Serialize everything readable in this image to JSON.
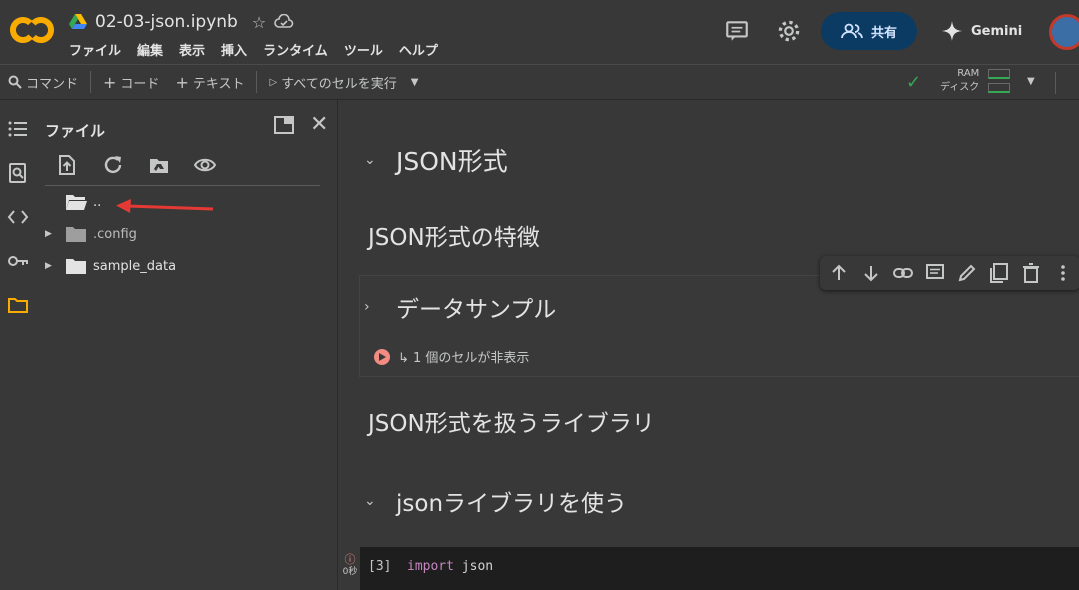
{
  "app": {
    "logo_text": "CO",
    "notebook_title": "02-03-json.ipynb",
    "menu": [
      "ファイル",
      "編集",
      "表示",
      "挿入",
      "ランタイム",
      "ツール",
      "ヘルプ"
    ],
    "share_label": "共有",
    "gemini_label": "Gemini"
  },
  "toolbar": {
    "command_label": "コマンド",
    "code_label": "コード",
    "text_label": "テキスト",
    "run_all_label": "すべてのセルを実行",
    "ram_label": "RAM",
    "disk_label": "ディスク"
  },
  "file_panel": {
    "title": "ファイル",
    "tree": [
      {
        "name": "..",
        "expandable": false
      },
      {
        "name": ".config",
        "expandable": true
      },
      {
        "name": "sample_data",
        "expandable": true
      }
    ]
  },
  "notebook": {
    "headings": [
      {
        "text": "JSON形式",
        "level": 1,
        "collapsible": true
      },
      {
        "text": "JSON形式の特徴",
        "level": 2,
        "collapsible": false
      },
      {
        "text": "データサンプル",
        "level": 2,
        "collapsible": true,
        "collapsed": true
      },
      {
        "text": "JSON形式を扱うライブラリ",
        "level": 2,
        "collapsible": false
      },
      {
        "text": "jsonライブラリを使う",
        "level": 1,
        "collapsible": true
      }
    ],
    "hidden_cells_text": "↳ 1 個のセルが非表示",
    "code_cell": {
      "exec_count": "[3]",
      "keyword": "import",
      "rest": " json",
      "exec_time": "0秒"
    }
  },
  "colors": {
    "background": "#383838",
    "accent_share": "#0b3a63",
    "status_green": "#34a853",
    "annotation_red": "#e53935"
  }
}
